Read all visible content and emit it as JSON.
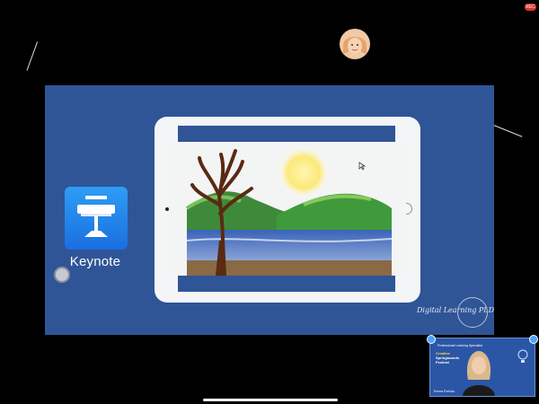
{
  "recording_badge": "REC",
  "slide": {
    "app_label": "Keynote",
    "signature": "Digital Learning PLD"
  },
  "pip": {
    "caption": "Professional Learning Specialist",
    "title_lines": [
      "Creative",
      "Springboards",
      "Festival"
    ],
    "name": "Emma Poricka"
  },
  "icons": {
    "keynote": "keynote-icon",
    "pointer": "pointer-icon",
    "memoji": "memoji-avatar",
    "bulb": "lightbulb-icon"
  },
  "colors": {
    "background": "#000000",
    "slide": "#2f5597",
    "keynote_icon": "#1f7ff0",
    "pip": "#2b56a6"
  }
}
